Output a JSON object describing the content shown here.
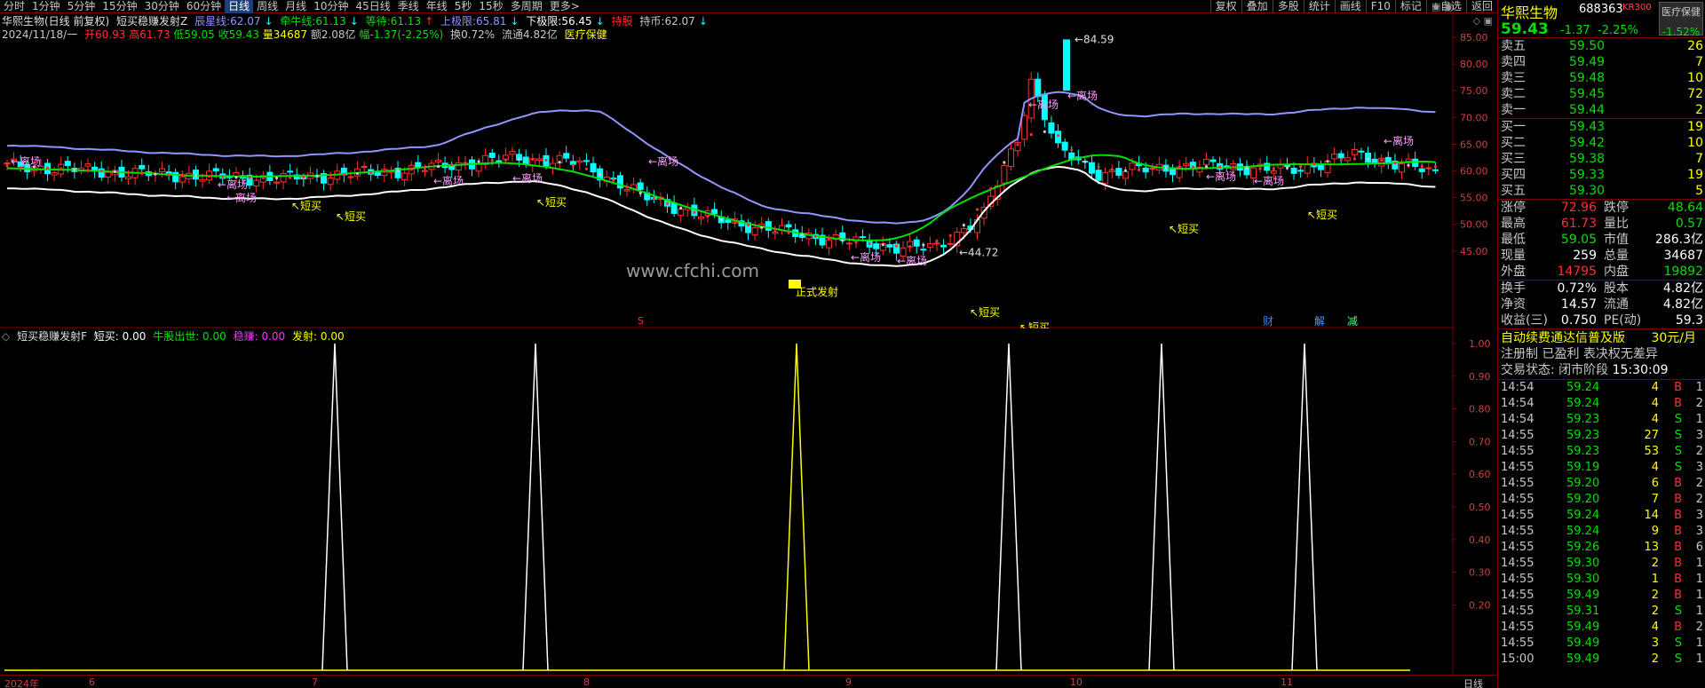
{
  "toolbar": {
    "periods": [
      "分时",
      "1分钟",
      "5分钟",
      "15分钟",
      "30分钟",
      "60分钟",
      "日线",
      "周线",
      "月线",
      "10分钟",
      "45日线",
      "季线",
      "年线",
      "5秒",
      "15秒",
      "多周期",
      "更多>"
    ],
    "active_period": "日线",
    "tools": [
      "复权",
      "叠加",
      "多股",
      "统计",
      "画线",
      "F10",
      "标记",
      "+自选",
      "返回"
    ]
  },
  "main_info": {
    "title": "华熙生物(日线 前复权)",
    "indicator_name": "短买稳赚发射Z",
    "chenxing_label": "辰星线:",
    "chenxing_value": "62.07",
    "qianniu_label": "牵牛线:",
    "qianniu_value": "61.13",
    "dengqi_label": "等待:",
    "dengqi_value": "61.13",
    "upper_label": "上极限:",
    "upper_value": "65.81",
    "lower_label": "下极限:",
    "lower_value": "56.45",
    "hold_label": "持股",
    "holdcash_label": "持币:",
    "holdcash_value": "62.07",
    "date": "2024/11/18/一",
    "open": "开60.93",
    "high": "高61.73",
    "low": "低59.05",
    "close": "收59.43",
    "volume": "量34687",
    "amount": "额2.08亿",
    "change": "幅-1.37(-2.25%)",
    "turnover": "换0.72%",
    "float": "流通4.82亿",
    "sector": "医疗保健"
  },
  "main_chart": {
    "price_ticks": [
      "85.00",
      "80.00",
      "75.00",
      "70.00",
      "65.00",
      "60.00",
      "55.00",
      "50.00",
      "45.00"
    ],
    "max_label": "84.59",
    "min_label": "44.72",
    "watermark": "www.cfchi.com",
    "labels_lichang": [
      "离场",
      "离场",
      "离场",
      "离场",
      "离场",
      "离场",
      "离场",
      "离场",
      "离场",
      "离场",
      "离场",
      "离场",
      "离场"
    ],
    "labels_duanmai": [
      "短买",
      "短买",
      "短买",
      "短买",
      "短买",
      "短买",
      "短买"
    ],
    "label_zhengshi": "正式发射",
    "label_s": "S",
    "signals_bottom": [
      "财",
      "解",
      "减"
    ]
  },
  "sub_info": {
    "name": "短买稳赚发射F",
    "duanmai": "短买: 0.00",
    "niuyao": "牛股出世: 0.00",
    "wenzhuan": "稳赚: 0.00",
    "fashe": "发射: 0.00",
    "ticks": [
      "1.00",
      "0.90",
      "0.80",
      "0.70",
      "0.60",
      "0.50",
      "0.40",
      "0.30",
      "0.20"
    ]
  },
  "x_axis": {
    "labels": [
      "2024年",
      "6",
      "7",
      "8",
      "9",
      "10",
      "11"
    ],
    "period_label": "日线"
  },
  "colors": {
    "up": "#ff3030",
    "down": "#00ffff",
    "upper_band": "#8f96ff",
    "lower_band": "#ffffff",
    "ma_green": "#00e000",
    "accent_yellow": "#ffff00",
    "frame_red": "#7a0000"
  },
  "quote": {
    "name": "华熙生物",
    "code": "688363",
    "tag": "KR300",
    "sector_btn": "医疗保健",
    "sector_pct": "-1.52%",
    "price": "59.43",
    "change": "-1.37",
    "change_pct": "-2.25%"
  },
  "sell": [
    {
      "label": "卖五",
      "price": "59.50",
      "vol": "26"
    },
    {
      "label": "卖四",
      "price": "59.49",
      "vol": "7"
    },
    {
      "label": "卖三",
      "price": "59.48",
      "vol": "10"
    },
    {
      "label": "卖二",
      "price": "59.45",
      "vol": "72"
    },
    {
      "label": "卖一",
      "price": "59.44",
      "vol": "2"
    }
  ],
  "buy": [
    {
      "label": "买一",
      "price": "59.43",
      "vol": "19"
    },
    {
      "label": "买二",
      "price": "59.42",
      "vol": "10"
    },
    {
      "label": "买三",
      "price": "59.38",
      "vol": "7"
    },
    {
      "label": "买四",
      "price": "59.33",
      "vol": "19"
    },
    {
      "label": "买五",
      "price": "59.30",
      "vol": "5"
    }
  ],
  "stats1": [
    {
      "l": "涨停",
      "lv": "72.96",
      "lc": "#ff3030",
      "r": "跌停",
      "rv": "48.64",
      "rc": "#00e000"
    },
    {
      "l": "最高",
      "lv": "61.73",
      "lc": "#ff3030",
      "r": "量比",
      "rv": "0.57",
      "rc": "#00e000"
    },
    {
      "l": "最低",
      "lv": "59.05",
      "lc": "#00e000",
      "r": "市值",
      "rv": "286.3亿",
      "rc": "#ffffff"
    },
    {
      "l": "现量",
      "lv": "259",
      "lc": "#ffffff",
      "r": "总量",
      "rv": "34687",
      "rc": "#ffffff"
    },
    {
      "l": "外盘",
      "lv": "14795",
      "lc": "#ff3030",
      "r": "内盘",
      "rv": "19892",
      "rc": "#00e000"
    }
  ],
  "stats2": [
    {
      "l": "换手",
      "lv": "0.72%",
      "lc": "#ffffff",
      "r": "股本",
      "rv": "4.82亿",
      "rc": "#ffffff"
    },
    {
      "l": "净资",
      "lv": "14.57",
      "lc": "#ffffff",
      "r": "流通",
      "rv": "4.82亿",
      "rc": "#ffffff"
    },
    {
      "l": "收益(三)",
      "lv": "0.750",
      "lc": "#ffffff",
      "r": "PE(动)",
      "rv": "59.3",
      "rc": "#ffffff"
    }
  ],
  "promo": {
    "title": "自动续费通达信普及版",
    "price": "30元/月",
    "line2": "注册制 已盈利 表决权无差异",
    "status_label": "交易状态: 闭市阶段",
    "status_time": "15:30:09"
  },
  "ticks": [
    {
      "t": "14:54",
      "p": "59.24",
      "v": "4",
      "s": "B",
      "n": "1"
    },
    {
      "t": "14:54",
      "p": "59.24",
      "v": "4",
      "s": "B",
      "n": "2"
    },
    {
      "t": "14:54",
      "p": "59.23",
      "v": "4",
      "s": "S",
      "n": "1"
    },
    {
      "t": "14:55",
      "p": "59.23",
      "v": "27",
      "s": "S",
      "n": "3"
    },
    {
      "t": "14:55",
      "p": "59.23",
      "v": "53",
      "s": "S",
      "n": "2"
    },
    {
      "t": "14:55",
      "p": "59.19",
      "v": "4",
      "s": "S",
      "n": "3"
    },
    {
      "t": "14:55",
      "p": "59.20",
      "v": "6",
      "s": "B",
      "n": "2"
    },
    {
      "t": "14:55",
      "p": "59.20",
      "v": "7",
      "s": "B",
      "n": "2"
    },
    {
      "t": "14:55",
      "p": "59.24",
      "v": "14",
      "s": "B",
      "n": "3"
    },
    {
      "t": "14:55",
      "p": "59.24",
      "v": "9",
      "s": "B",
      "n": "3"
    },
    {
      "t": "14:55",
      "p": "59.26",
      "v": "13",
      "s": "B",
      "n": "6"
    },
    {
      "t": "14:55",
      "p": "59.30",
      "v": "2",
      "s": "B",
      "n": "1"
    },
    {
      "t": "14:55",
      "p": "59.30",
      "v": "1",
      "s": "B",
      "n": "1"
    },
    {
      "t": "14:55",
      "p": "59.49",
      "v": "2",
      "s": "B",
      "n": "1"
    },
    {
      "t": "14:55",
      "p": "59.31",
      "v": "2",
      "s": "S",
      "n": "1"
    },
    {
      "t": "14:55",
      "p": "59.49",
      "v": "4",
      "s": "B",
      "n": "2"
    },
    {
      "t": "14:55",
      "p": "59.49",
      "v": "3",
      "s": "S",
      "n": "1"
    },
    {
      "t": "15:00",
      "p": "59.49",
      "v": "2",
      "s": "S",
      "n": "1"
    }
  ]
}
